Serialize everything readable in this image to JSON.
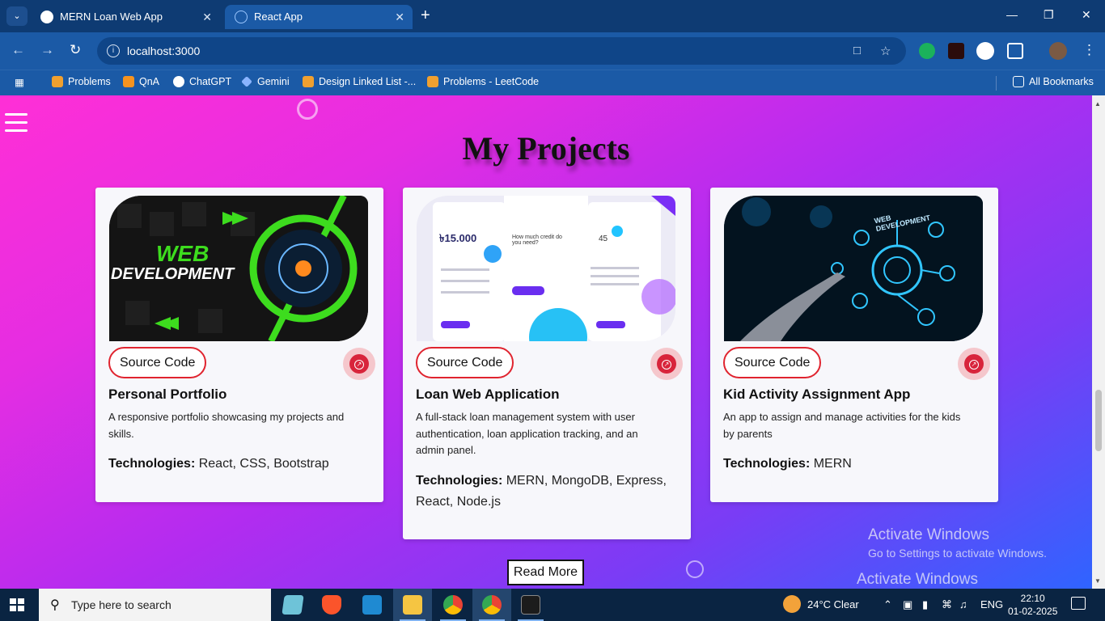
{
  "browser": {
    "tabs": [
      {
        "title": "MERN Loan Web App",
        "active": false
      },
      {
        "title": "React App",
        "active": true
      }
    ],
    "url": "localhost:3000",
    "bookmarks": [
      "Problems",
      "QnA",
      "ChatGPT",
      "Gemini",
      "Design Linked List -...",
      "Problems - LeetCode"
    ],
    "all_bookmarks": "All Bookmarks"
  },
  "page": {
    "title": "My Projects",
    "projects": [
      {
        "source_label": "Source Code",
        "title": "Personal Portfolio",
        "description": "A responsive portfolio showcasing my projects and skills.",
        "tech_label": "Technologies:",
        "tech": "React, CSS, Bootstrap",
        "image_text_1": "WEB",
        "image_text_2": "DEVELOPMENT"
      },
      {
        "source_label": "Source Code",
        "title": "Loan Web Application",
        "description": "A full-stack loan management system with user authentication, loan application tracking, and an admin panel.",
        "tech_label": "Technologies:",
        "tech": "MERN, MongoDB, Express, React, Node.js",
        "image_text_1": "৳15.000",
        "image_text_2": "How much credit do you need?",
        "image_text_3": "45"
      },
      {
        "source_label": "Source Code",
        "title": "Kid Activity Assignment App",
        "description": "An app to assign and manage activities for the kids by parents",
        "tech_label": "Technologies:",
        "tech": "MERN",
        "image_text_1": "WEB DEVELOPMENT"
      }
    ],
    "read_more": "Read More"
  },
  "watermark": {
    "line1": "Activate Windows",
    "line2": "Go to Settings to activate Windows.",
    "line3": "Activate Windows"
  },
  "taskbar": {
    "search_placeholder": "Type here to search",
    "weather": "24°C  Clear",
    "language": "ENG",
    "time": "22:10",
    "date": "01-02-2025"
  }
}
